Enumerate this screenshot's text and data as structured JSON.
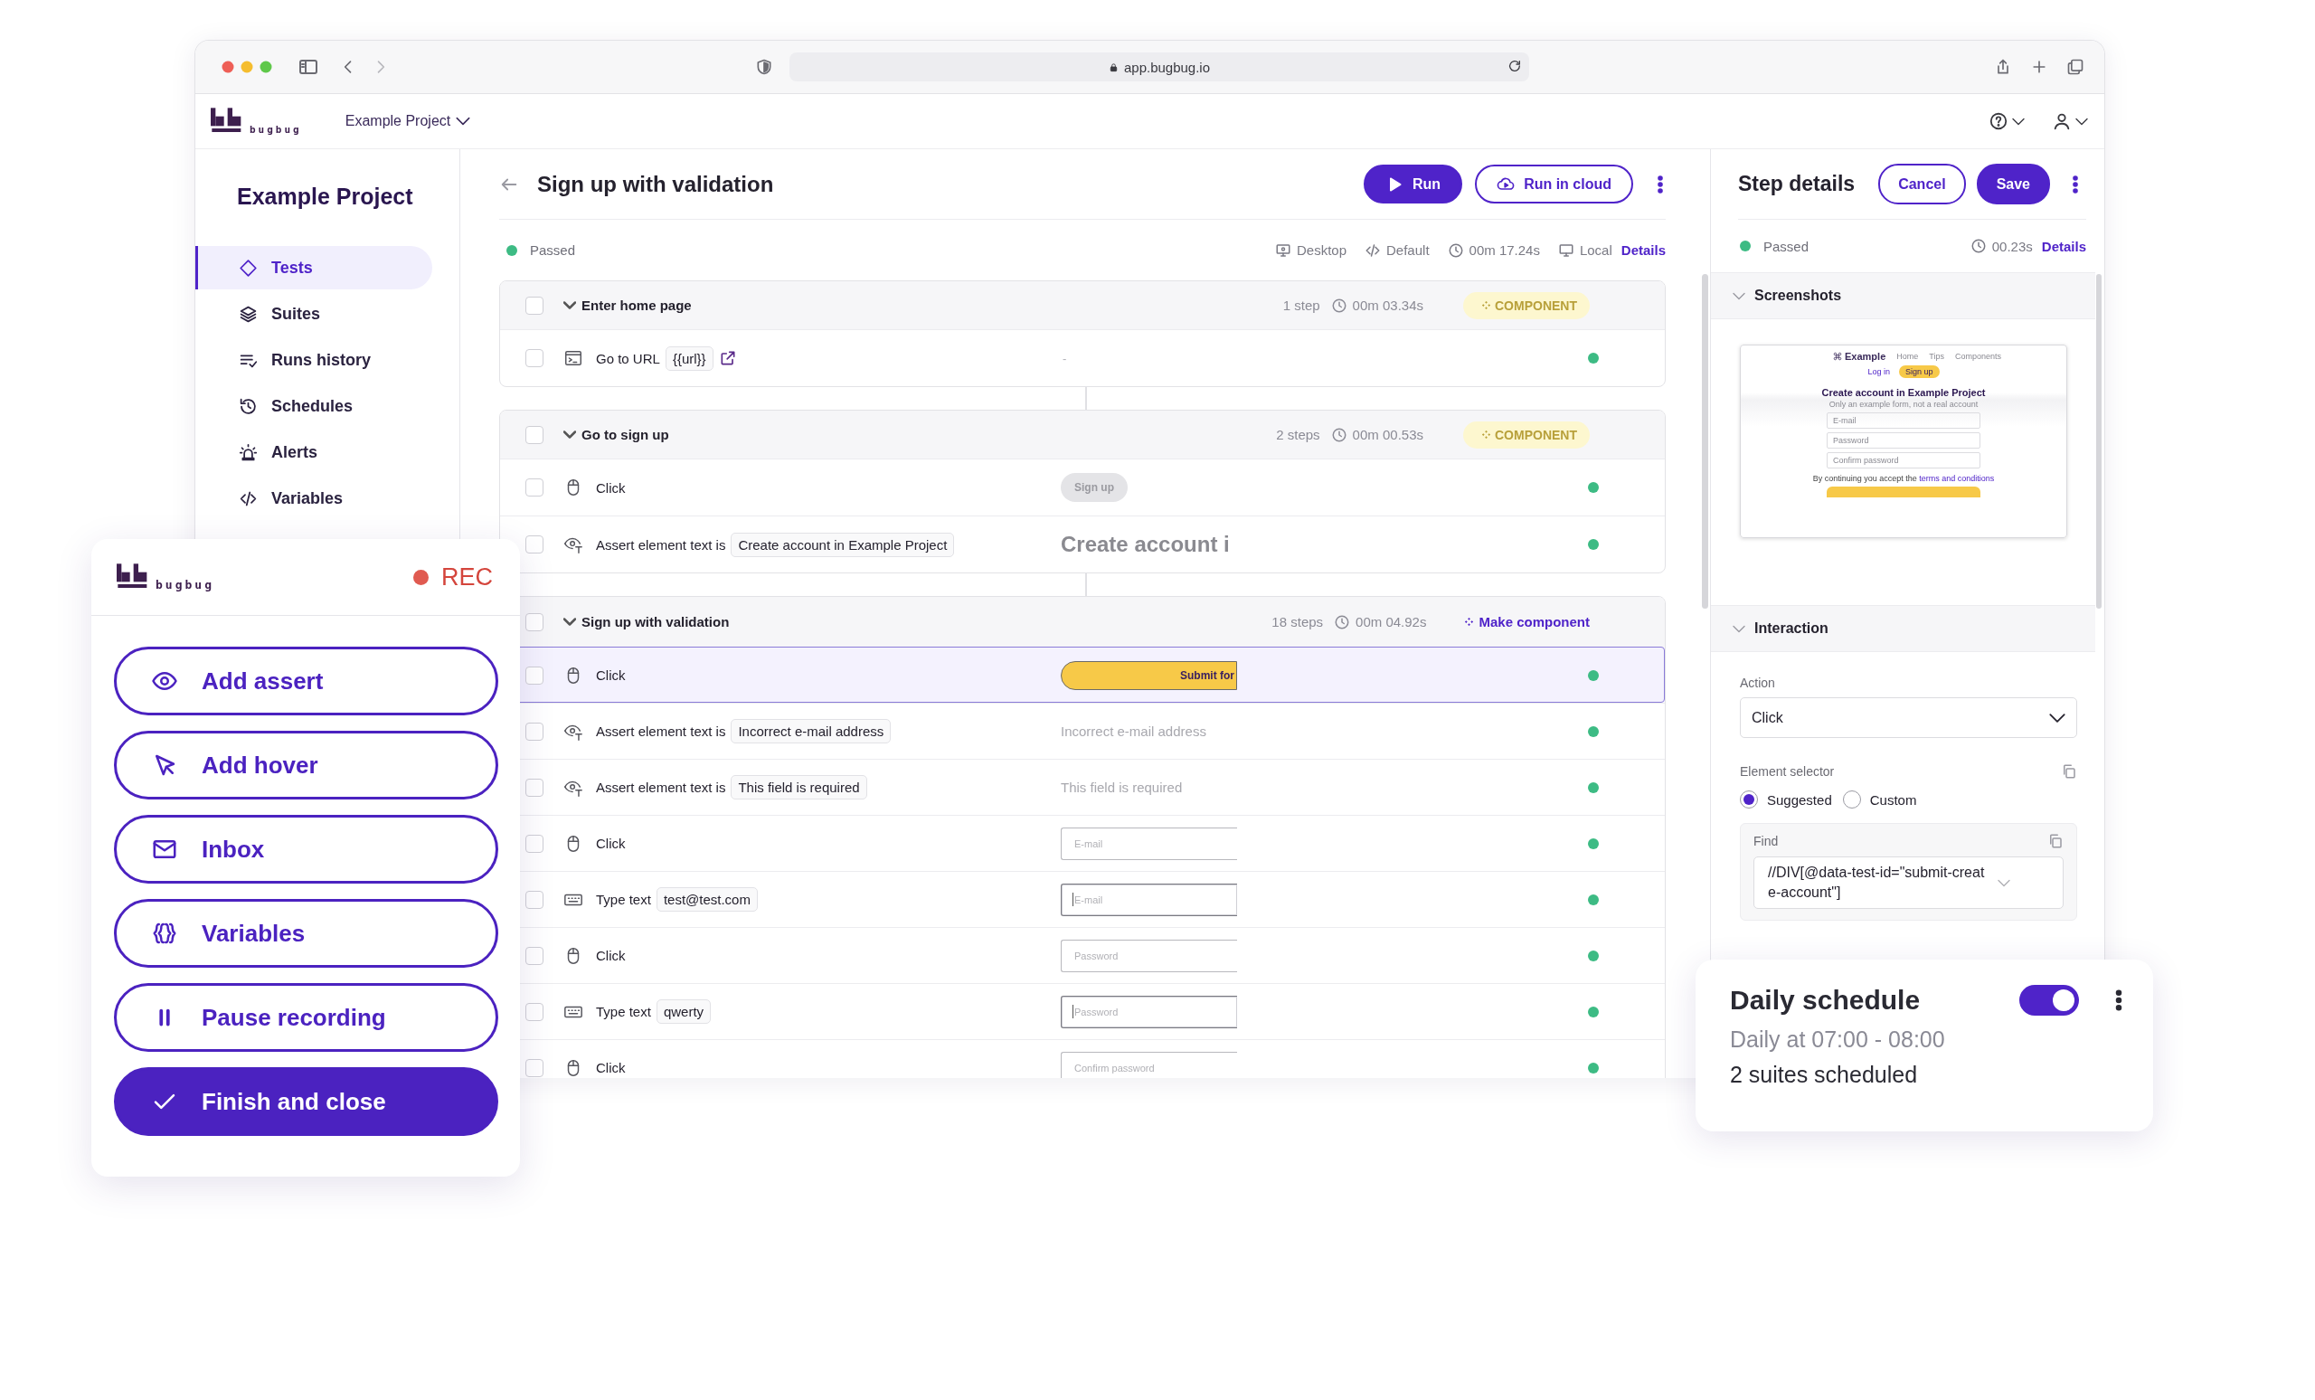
{
  "browser": {
    "url": "app.bugbug.io"
  },
  "app_header": {
    "logo": "bugbug",
    "project": "Example Project"
  },
  "sidebar": {
    "title": "Example Project",
    "items": [
      {
        "label": "Tests",
        "selected": true
      },
      {
        "label": "Suites",
        "selected": false
      },
      {
        "label": "Runs history",
        "selected": false
      },
      {
        "label": "Schedules",
        "selected": false
      },
      {
        "label": "Alerts",
        "selected": false
      },
      {
        "label": "Variables",
        "selected": false
      }
    ]
  },
  "test": {
    "title": "Sign up with validation",
    "buttons": [
      {
        "kind": "primary",
        "label": "Run"
      },
      {
        "kind": "outline",
        "label": "Run in cloud"
      }
    ],
    "status": "Passed",
    "meta": [
      "Desktop",
      "Default",
      "00m 17.24s",
      "Local"
    ],
    "details": "Details",
    "groups": [
      {
        "title": "Enter home page",
        "expanded": true,
        "checked": false,
        "steps_count": "1 step",
        "duration": "00m 03.34s",
        "badge": {
          "kind": "component",
          "text": "COMPONENT"
        },
        "steps": [
          {
            "kind": "goto",
            "action": "Go to URL",
            "value": "{{url}}",
            "checked": false,
            "selected": false,
            "preview": {
              "kind": "dash",
              "text": "-"
            }
          }
        ]
      },
      {
        "title": "Go to sign up",
        "expanded": true,
        "checked": false,
        "steps_count": "2 steps",
        "duration": "00m 00.53s",
        "badge": {
          "kind": "component",
          "text": "COMPONENT"
        },
        "steps": [
          {
            "kind": "click",
            "action": "Click",
            "checked": false,
            "selected": false,
            "preview": {
              "kind": "pill",
              "text": "Sign up"
            }
          },
          {
            "kind": "assert",
            "action": "Assert element text is",
            "value": "Create account in Example Project",
            "checked": false,
            "selected": false,
            "preview": {
              "kind": "large-text",
              "text": "Create account i"
            }
          }
        ]
      },
      {
        "title": "Sign up with validation",
        "expanded": true,
        "checked": false,
        "steps_count": "18 steps",
        "duration": "00m 04.92s",
        "badge": {
          "kind": "link",
          "text": "Make component"
        },
        "steps": [
          {
            "kind": "click",
            "action": "Click",
            "checked": false,
            "selected": true,
            "preview": {
              "kind": "button",
              "text": "Submit for"
            }
          },
          {
            "kind": "assert",
            "action": "Assert element text is",
            "value": "Incorrect e-mail address",
            "checked": false,
            "selected": false,
            "preview": {
              "kind": "text",
              "text": "Incorrect e-mail address"
            }
          },
          {
            "kind": "assert",
            "action": "Assert element text is",
            "value": "This field is required",
            "checked": false,
            "selected": false,
            "preview": {
              "kind": "text",
              "text": "This field is required"
            }
          },
          {
            "kind": "click",
            "action": "Click",
            "checked": false,
            "selected": false,
            "preview": {
              "kind": "input",
              "placeholder": "E-mail",
              "focused": false
            }
          },
          {
            "kind": "type",
            "action": "Type text",
            "value": "test@test.com",
            "checked": false,
            "selected": false,
            "preview": {
              "kind": "input",
              "placeholder": "E-mail",
              "focused": true
            }
          },
          {
            "kind": "click",
            "action": "Click",
            "checked": false,
            "selected": false,
            "preview": {
              "kind": "input",
              "placeholder": "Password",
              "focused": false
            }
          },
          {
            "kind": "type",
            "action": "Type text",
            "value": "qwerty",
            "checked": false,
            "selected": false,
            "preview": {
              "kind": "input",
              "placeholder": "Password",
              "focused": true
            }
          },
          {
            "kind": "click",
            "action": "Click",
            "checked": false,
            "selected": false,
            "preview": {
              "kind": "input",
              "placeholder": "Confirm password",
              "focused": false
            }
          }
        ]
      }
    ]
  },
  "step_details": {
    "title": "Step details",
    "buttons": [
      {
        "kind": "outline",
        "label": "Cancel"
      },
      {
        "kind": "primary",
        "label": "Save"
      }
    ],
    "status": "Passed",
    "duration": "00.23s",
    "details": "Details",
    "sections": [
      {
        "kind": "screenshots",
        "title": "Screenshots",
        "expanded": true
      },
      {
        "kind": "interaction",
        "title": "Interaction",
        "expanded": true
      }
    ],
    "screenshot": {
      "brand": "Example",
      "nav": [
        "Home",
        "Tips",
        "Components"
      ],
      "login": "Log in",
      "signup": "Sign up",
      "heading": "Create account in Example Project",
      "subheading": "Only an example form, not a real account",
      "fields": [
        "E-mail",
        "Password",
        "Confirm password"
      ],
      "consent": "By continuing you accept the",
      "consent_link": "terms and conditions"
    },
    "interaction": {
      "action_label": "Action",
      "action_value": "Click",
      "selector_label": "Element selector",
      "selector_options": [
        {
          "label": "Suggested",
          "selected": true
        },
        {
          "label": "Custom",
          "selected": false
        }
      ],
      "find_label": "Find",
      "find_value": "//DIV[@data-test-id=\"submit-create-account\"]"
    }
  },
  "recorder": {
    "logo": "bugbug",
    "rec": "REC",
    "buttons": [
      {
        "kind": "outline",
        "label": "Add assert"
      },
      {
        "kind": "outline",
        "label": "Add hover"
      },
      {
        "kind": "outline",
        "label": "Inbox"
      },
      {
        "kind": "outline",
        "label": "Variables"
      },
      {
        "kind": "outline",
        "label": "Pause recording"
      },
      {
        "kind": "primary",
        "label": "Finish and close"
      }
    ]
  },
  "schedule": {
    "title": "Daily schedule",
    "enabled": true,
    "time": "Daily at 07:00 - 08:00",
    "suites": "2 suites scheduled"
  }
}
